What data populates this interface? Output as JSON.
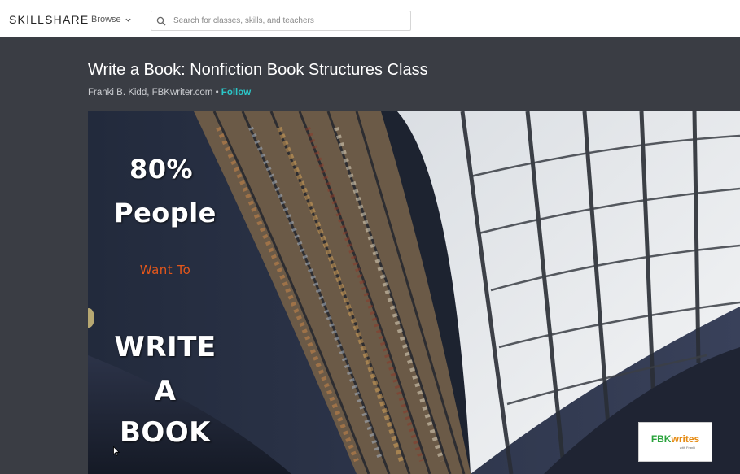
{
  "header": {
    "logo": "SKILLSHARE",
    "browse_label": "Browse",
    "search_placeholder": "Search for classes, skills, and teachers",
    "search_value": ""
  },
  "class": {
    "title": "Write a Book: Nonfiction Book Structures Class",
    "teacher": "Franki B. Kidd, FBKwriter.com",
    "separator": " • ",
    "follow_label": "Follow"
  },
  "video": {
    "line1": "80%",
    "line2": "People",
    "line3": "Want To",
    "line4": "WRITE",
    "line5": "A",
    "line6": "BOOK",
    "badge_part1": "FBK",
    "badge_part2": "writes",
    "badge_sub": "with Franki"
  },
  "colors": {
    "accent_follow": "#2bc7c8",
    "page_bg": "#3a3d44",
    "want_to": "#e4571b"
  },
  "icons": {
    "search": "search-icon",
    "browse_caret": "chevron-down-icon"
  }
}
